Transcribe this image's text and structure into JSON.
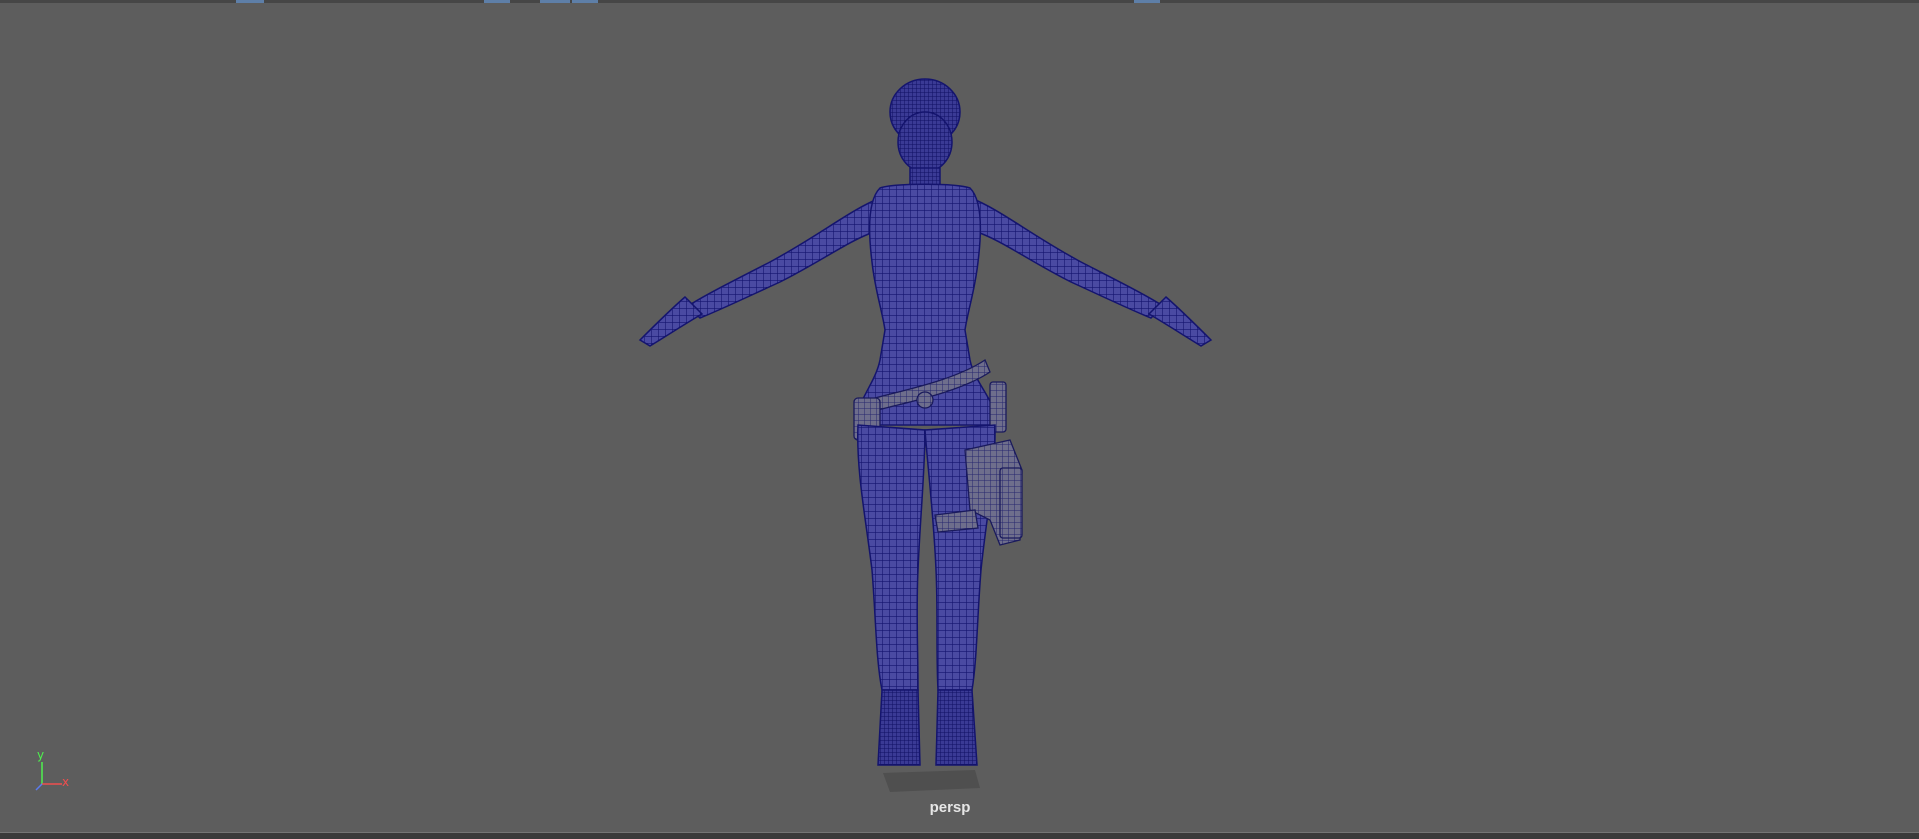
{
  "viewport": {
    "camera_name": "persp",
    "background_color": "#5d5d5d",
    "wireframe_color": "#1f1f86",
    "content": "character-wireframe-model",
    "pose": "t-pose"
  },
  "axis_gizmo": {
    "y_label": "y",
    "x_label": "x",
    "y_color": "#4ef04e",
    "x_color": "#f04e4e",
    "z_color": "#5a7cf0"
  }
}
